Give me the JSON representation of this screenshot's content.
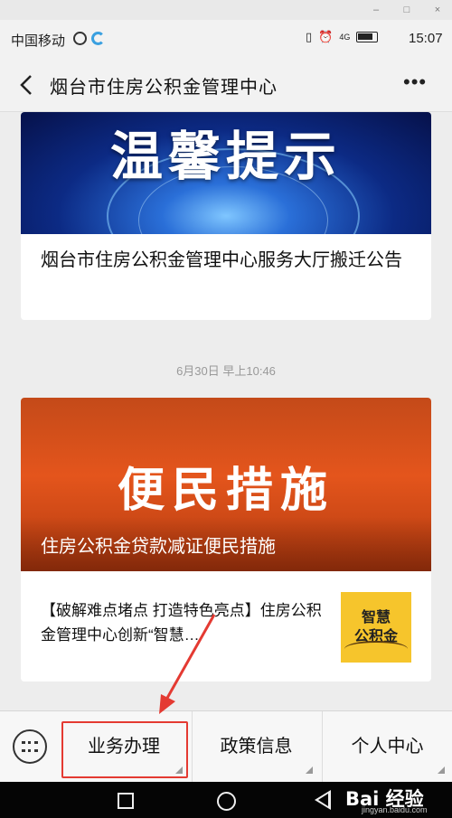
{
  "window": {
    "minimize": "–",
    "maximize": "□",
    "close": "×"
  },
  "status": {
    "carrier": "中国移动",
    "signal": "4G",
    "time": "15:07"
  },
  "nav": {
    "title": "烟台市住房公积金管理中心",
    "more": "•••"
  },
  "articles": [
    {
      "banner_text": "温馨提示",
      "title": "烟台市住房公积金管理中心服务大厅搬迁公告"
    },
    {
      "banner_text": "便民措施",
      "banner_caption": "住房公积金贷款减证便民措施",
      "body": "【破解难点堵点 打造特色亮点】住房公积金管理中心创新“智慧…",
      "thumb_text": "智慧\n公积金"
    }
  ],
  "timestamp": "6月30日 早上10:46",
  "menu": [
    "业务办理",
    "政策信息",
    "个人中心"
  ],
  "watermark": {
    "main": "Bai 经验",
    "sub": "jingyan.baidu.com"
  },
  "colors": {
    "highlight": "#e43a32",
    "banner_blue": "#0c2a84",
    "banner_orange": "#e4551c",
    "thumb_yellow": "#f6c52c"
  }
}
